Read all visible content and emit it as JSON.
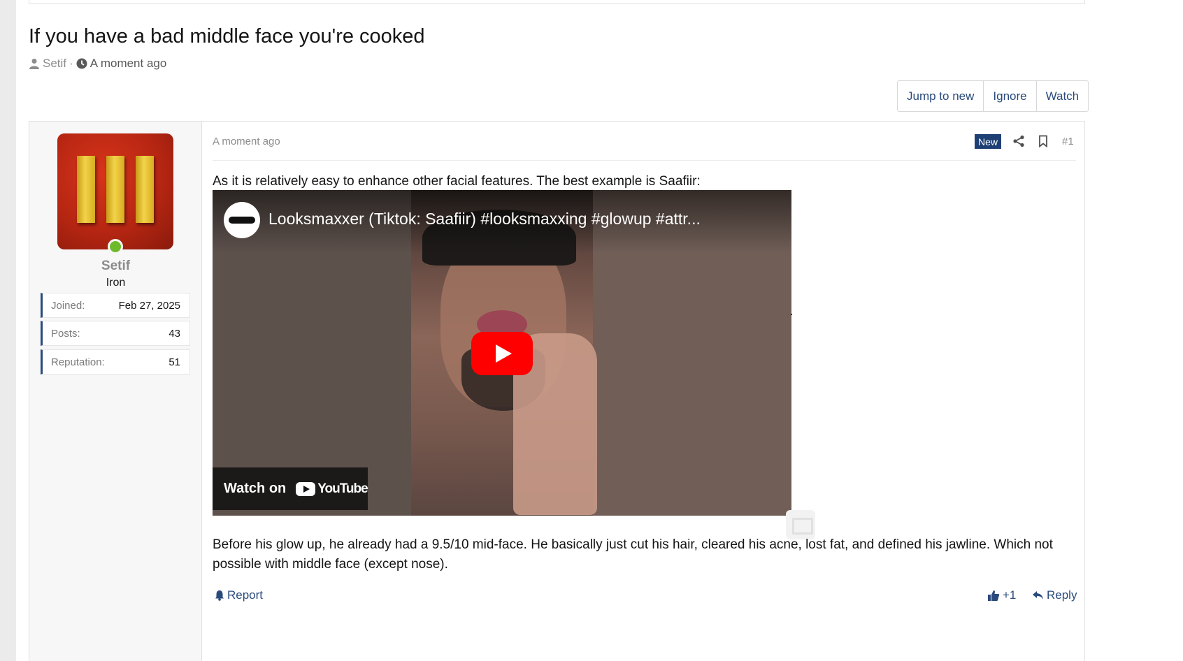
{
  "thread": {
    "title": "If you have a bad middle face you're cooked",
    "author": "Setif",
    "separator": "·",
    "time": "A moment ago"
  },
  "actions": {
    "jump_to_new": "Jump to new",
    "ignore": "Ignore",
    "watch": "Watch"
  },
  "user": {
    "name": "Setif",
    "title": "Iron",
    "online": true,
    "stats": [
      {
        "label": "Joined:",
        "value": "Feb 27, 2025"
      },
      {
        "label": "Posts:",
        "value": "43"
      },
      {
        "label": "Reputation:",
        "value": "51"
      }
    ]
  },
  "post": {
    "time": "A moment ago",
    "badge": "New",
    "number": "#1",
    "paragraph1": "As it is relatively easy to enhance other facial features. The best example is Saafiir:",
    "paragraph2_line1": "Before his glow up, he already had a 9.5/10 mid-face. He basically just cut his hair, cleared his acne, lost fat, and defined his jawline. Which not",
    "paragraph2_line2": "possible with middle face (except nose).",
    "video": {
      "title": "Looksmaxxer (Tiktok: Saafiir) #looksmaxxing #glowup #attr...",
      "watch_on": "Watch on",
      "brand": "YouTube"
    },
    "report": "Report",
    "reaction_count": "+1",
    "reply": "Reply"
  }
}
